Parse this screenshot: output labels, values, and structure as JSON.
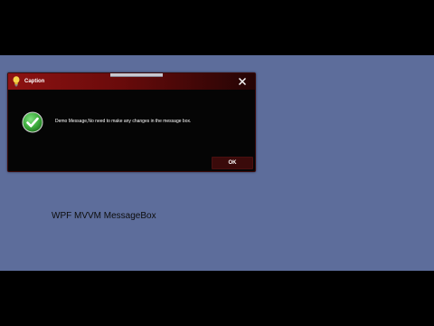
{
  "dialog": {
    "caption": "Caption",
    "message": "Demo Message,No need to make any changes in the message box.",
    "ok_label": "OK",
    "close_glyph": "✕",
    "icons": {
      "caption_icon": "lightbulb-icon",
      "message_icon": "success-check-icon",
      "close_icon": "close-icon"
    }
  },
  "desktop": {
    "label": "WPF MVVM MessageBox"
  },
  "colors": {
    "desktop_background": "#5d6d9b",
    "titlebar_start": "#8e1212",
    "titlebar_end": "#240404",
    "dialog_body": "#050505",
    "ok_button": "#3a0a0a",
    "success_green": "#3cab3c"
  }
}
